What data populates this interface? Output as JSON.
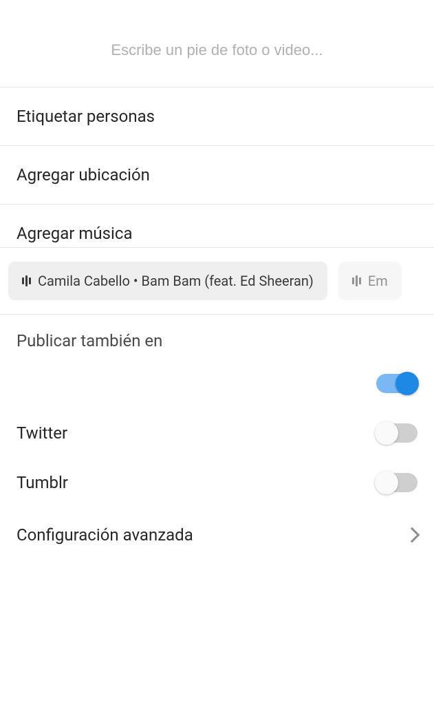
{
  "caption": {
    "placeholder": "Escribe un pie de foto o video..."
  },
  "options": {
    "tag_people": "Etiquetar personas",
    "add_location": "Agregar ubicación",
    "add_music": "Agregar música"
  },
  "music_suggestions": [
    {
      "label": "Camila Cabello • Bam Bam (feat. Ed Sheeran)"
    },
    {
      "label": "Em"
    }
  ],
  "share": {
    "title": "Publicar también en",
    "items": [
      {
        "name": "",
        "enabled": true
      },
      {
        "name": "Twitter",
        "enabled": false
      },
      {
        "name": "Tumblr",
        "enabled": false
      }
    ]
  },
  "advanced": {
    "label": "Configuración avanzada"
  }
}
